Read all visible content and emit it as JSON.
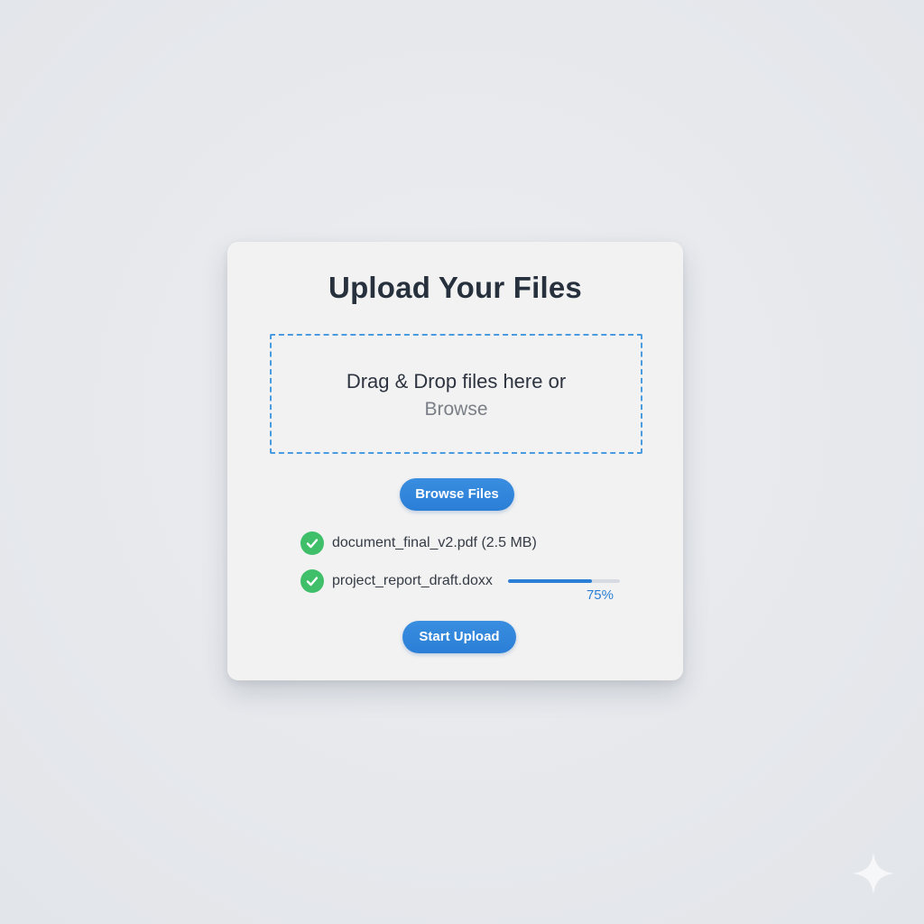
{
  "dialog": {
    "title": "Upload Your Files"
  },
  "dropzone": {
    "main_text": "Drag & Drop files here or",
    "browse_text": "Browse"
  },
  "browse_button": {
    "label": "Browse Files"
  },
  "files": [
    {
      "name": "document_final_v2.pdf (2.5 MB)",
      "status_icon": "check-circle-icon",
      "status_color": "#3fbf6a"
    },
    {
      "name": "project_report_draft.doxx",
      "status_icon": "check-circle-icon",
      "status_color": "#3fbf6a",
      "progress": 0.75,
      "progress_label": "75%"
    }
  ],
  "start_button": {
    "label": "Start Upload"
  },
  "colors": {
    "accent": "#2a7ed6",
    "dropzone_border": "#4a9be0",
    "success": "#3fbf6a",
    "title": "#27303d",
    "card_background": "#f2f2f2",
    "page_background": "#e7e9ed"
  },
  "decoration": {
    "corner_icon": "sparkle-icon"
  }
}
